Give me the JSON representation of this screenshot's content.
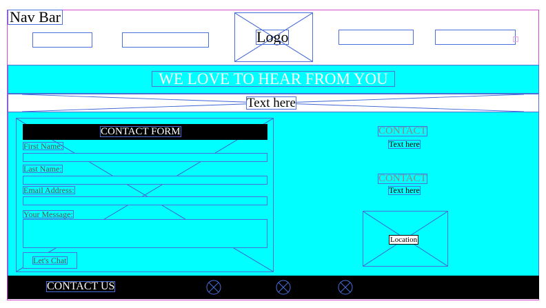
{
  "nav": {
    "label": "Nav Bar",
    "logo": "Logo"
  },
  "banner": {
    "heading": "WE LOVE TO HEAR FROM YOU"
  },
  "subheader": {
    "text": "Text here"
  },
  "form": {
    "title": "CONTACT FORM",
    "first_name_label": "First Name:",
    "last_name_label": "Last Name:",
    "email_label": "Email Address:",
    "message_label": "Your Message:",
    "chat_button": "Let's Chat"
  },
  "contacts": [
    {
      "title": "CONTACT",
      "text": "Text here"
    },
    {
      "title": "CONTACT",
      "text": "Text here"
    }
  ],
  "location": {
    "label": "Location"
  },
  "footer": {
    "label": "CONTACT US"
  },
  "colors": {
    "accent": "#00ffff",
    "dark": "#000000",
    "outline": "#4a6fdc",
    "frame": "#d24bd2"
  }
}
